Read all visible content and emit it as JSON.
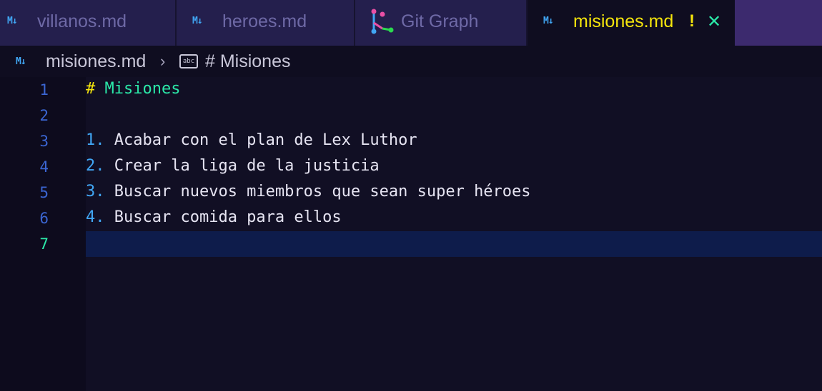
{
  "tabs": [
    {
      "label": "villanos.md",
      "icon": "markdown-icon"
    },
    {
      "label": "heroes.md",
      "icon": "markdown-icon"
    },
    {
      "label": "Git Graph",
      "icon": "git-graph-icon"
    },
    {
      "label": "misiones.md",
      "icon": "markdown-icon",
      "dirty": "!",
      "close": "✕"
    }
  ],
  "breadcrumb": {
    "file": "misiones.md",
    "separator": "›",
    "symbol_icon": "abc",
    "symbol": "# Misiones"
  },
  "editor": {
    "line_numbers": [
      "1",
      "2",
      "3",
      "4",
      "5",
      "6",
      "7"
    ],
    "lines": [
      {
        "marker": "#",
        "text": "Misiones"
      },
      {
        "marker": "",
        "text": ""
      },
      {
        "marker": "1.",
        "text": "Acabar con el plan de Lex Luthor"
      },
      {
        "marker": "2.",
        "text": "Crear la liga de la justicia"
      },
      {
        "marker": "3.",
        "text": "Buscar nuevos miembros que sean super héroes"
      },
      {
        "marker": "4.",
        "text": "Buscar comida para ellos"
      },
      {
        "marker": "",
        "text": ""
      }
    ],
    "current_line": "7"
  },
  "colors": {
    "accent": "#f5e50c",
    "heading": "#2be8a8",
    "list_marker": "#41a7f5",
    "background": "#0f0d20"
  }
}
